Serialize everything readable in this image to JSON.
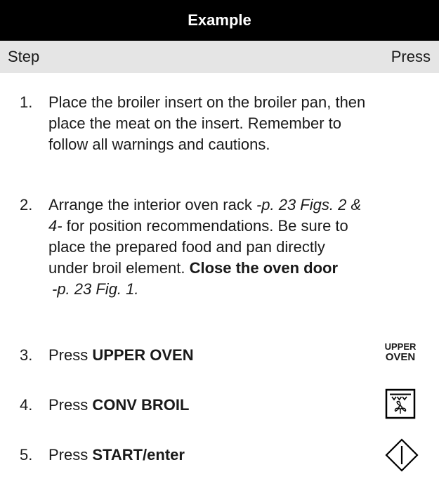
{
  "header": {
    "title": "Example"
  },
  "columns": {
    "step": "Step",
    "press": "Press"
  },
  "steps": [
    {
      "num": "1.",
      "lines": [
        "Place the broiler insert on the broiler pan, then",
        "place the meat on the insert. Remember to",
        "follow all warnings and cautions."
      ]
    },
    {
      "num": "2.",
      "l1_a": "Arrange the interior oven rack ",
      "l1_b": "-p. 23 Figs. 2 &",
      "l2_a": "4-",
      "l2_b": " for position recommendations. Be sure to",
      "l3": "place the prepared food and pan directly",
      "l4_a": "under broil element. ",
      "l4_b": "Close the oven door",
      "l5": "-p. 23 Fig. 1."
    },
    {
      "num": "3.",
      "prefix": "Press ",
      "key": "UPPER OVEN"
    },
    {
      "num": "4.",
      "prefix": "Press ",
      "key": "CONV BROIL"
    },
    {
      "num": "5.",
      "prefix": "Press ",
      "key": "START/enter"
    }
  ],
  "keypad": {
    "upper_oven_line1": "UPPER",
    "upper_oven_line2": "OVEN",
    "conv_broil_icon": "convection-broil-icon",
    "start_icon": "start-enter-icon"
  }
}
